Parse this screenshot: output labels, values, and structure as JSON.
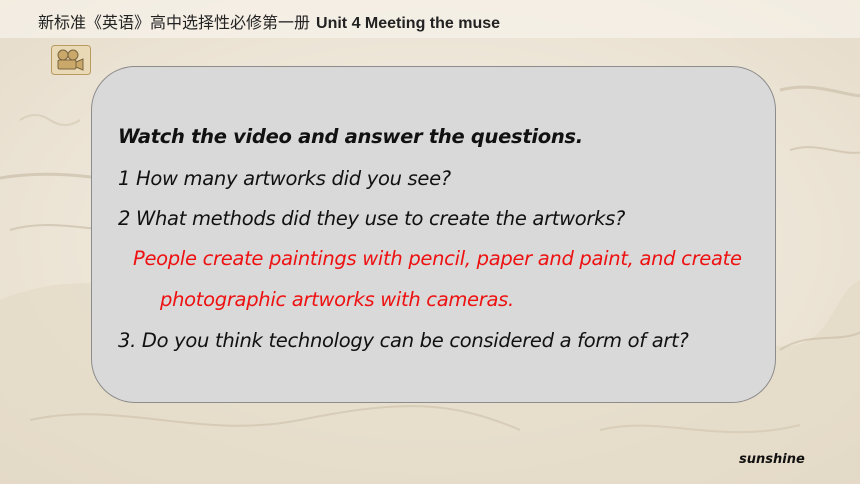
{
  "header": {
    "title_cn": "新标准《英语》高中选择性必修第一册",
    "title_en": "Unit 4 Meeting the muse"
  },
  "icons": {
    "video": "video-camera-icon"
  },
  "card": {
    "heading": "Watch the video and answer the questions.",
    "q1": "1 How many artworks did you see?",
    "q2": "2 What methods did they use to create the artworks?",
    "answer_line1": "People create paintings with pencil, paper and paint, and create",
    "answer_line2": "photographic artworks with cameras.",
    "q3": "3. Do you think technology can be considered a form of art?"
  },
  "footer": {
    "brand": "sunshine"
  },
  "colors": {
    "answer": "#ee1111",
    "card_fill": "#d9d9d9",
    "background": "#f1ebdf"
  }
}
